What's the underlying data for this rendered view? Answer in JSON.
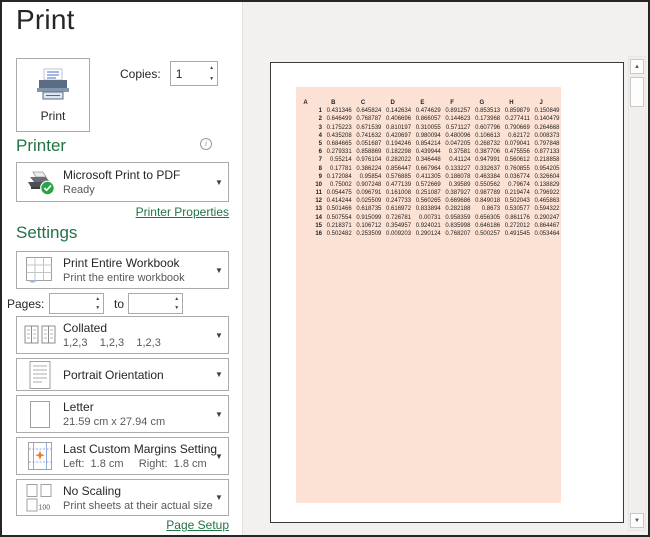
{
  "window": {
    "title": "Print"
  },
  "toolbar": {
    "print_label": "Print",
    "copies_label": "Copies:",
    "copies_value": "1"
  },
  "printer": {
    "heading": "Printer",
    "name": "Microsoft Print to PDF",
    "status": "Ready",
    "properties_link": "Printer Properties"
  },
  "settings": {
    "heading": "Settings",
    "print_what": {
      "label": "Print Entire Workbook",
      "sublabel": "Print the entire workbook"
    },
    "pages": {
      "label": "Pages:",
      "to": "to",
      "from_value": "",
      "to_value": ""
    },
    "collation": {
      "label": "Collated",
      "sublabel": "1,2,3    1,2,3    1,2,3"
    },
    "orientation": {
      "label": "Portrait Orientation"
    },
    "paper": {
      "label": "Letter",
      "sublabel": "21.59 cm x 27.94 cm"
    },
    "margins": {
      "label": "Last Custom Margins Setting",
      "sublabel": "Left:  1.8 cm     Right:  1.8 cm"
    },
    "scaling": {
      "label": "No Scaling",
      "sublabel": "Print sheets at their actual size"
    },
    "page_setup_link": "Page Setup"
  },
  "preview": {
    "fill_color": "#fbe2d4",
    "column_headers": [
      "A",
      "B",
      "C",
      "D",
      "E",
      "F",
      "G",
      "H",
      "J"
    ],
    "rows": [
      [
        "1",
        "0.431346",
        "0.645824",
        "0.142634",
        "0.474629",
        "0.891257",
        "0.853513",
        "0.859879",
        "0.150849"
      ],
      [
        "2",
        "0.646499",
        "0.768787",
        "0.406696",
        "0.866057",
        "0.144623",
        "0.173968",
        "0.277411",
        "0.140479"
      ],
      [
        "3",
        "0.175223",
        "0.671539",
        "0.810197",
        "0.310055",
        "0.571127",
        "0.607796",
        "0.790669",
        "0.264668"
      ],
      [
        "4",
        "0.435208",
        "0.741632",
        "0.420697",
        "0.980094",
        "0.480096",
        "0.106613",
        "0.62172",
        "0.008373"
      ],
      [
        "5",
        "0.684665",
        "0.051687",
        "0.194246",
        "0.854214",
        "0.047205",
        "0.268732",
        "0.079041",
        "0.797848"
      ],
      [
        "6",
        "0.279331",
        "0.858869",
        "0.182298",
        "0.439944",
        "0.37581",
        "0.387706",
        "0.475556",
        "0.877133"
      ],
      [
        "7",
        "0.55214",
        "0.976104",
        "0.282022",
        "0.346448",
        "0.41124",
        "0.947991",
        "0.560612",
        "0.218858"
      ],
      [
        "8",
        "0.17781",
        "0.386224",
        "0.856447",
        "0.667964",
        "0.133227",
        "0.332637",
        "0.760855",
        "0.954205"
      ],
      [
        "9",
        "0.172084",
        "0.95854",
        "0.576885",
        "0.411305",
        "0.186078",
        "0.463384",
        "0.036774",
        "0.326604"
      ],
      [
        "10",
        "0.75002",
        "0.907248",
        "0.477139",
        "0.572669",
        "0.39589",
        "0.550562",
        "0.79674",
        "0.138829"
      ],
      [
        "11",
        "0.054475",
        "0.096791",
        "0.161008",
        "0.251087",
        "0.387927",
        "0.987789",
        "0.219474",
        "0.796922"
      ],
      [
        "12",
        "0.414244",
        "0.025509",
        "0.247733",
        "0.560265",
        "0.669686",
        "0.849018",
        "0.502043",
        "0.465863"
      ],
      [
        "13",
        "0.501466",
        "0.618735",
        "0.616972",
        "0.833894",
        "0.282188",
        "0.8673",
        "0.530577",
        "0.594322"
      ],
      [
        "14",
        "0.507554",
        "0.915099",
        "0.726781",
        "0.00731",
        "0.958359",
        "0.656305",
        "0.861176",
        "0.290247"
      ],
      [
        "15",
        "0.218371",
        "0.106712",
        "0.354957",
        "0.924021",
        "0.835998",
        "0.646186",
        "0.272012",
        "0.864467"
      ],
      [
        "16",
        "0.502482",
        "0.253509",
        "0.009203",
        "0.290124",
        "0.768207",
        "0.500257",
        "0.491545",
        "0.053464"
      ]
    ]
  },
  "colors": {
    "accent_green": "#217346",
    "status_badge_green": "#26a343",
    "peach_fill": "#fbe2d4",
    "control_border": "#ababab"
  }
}
